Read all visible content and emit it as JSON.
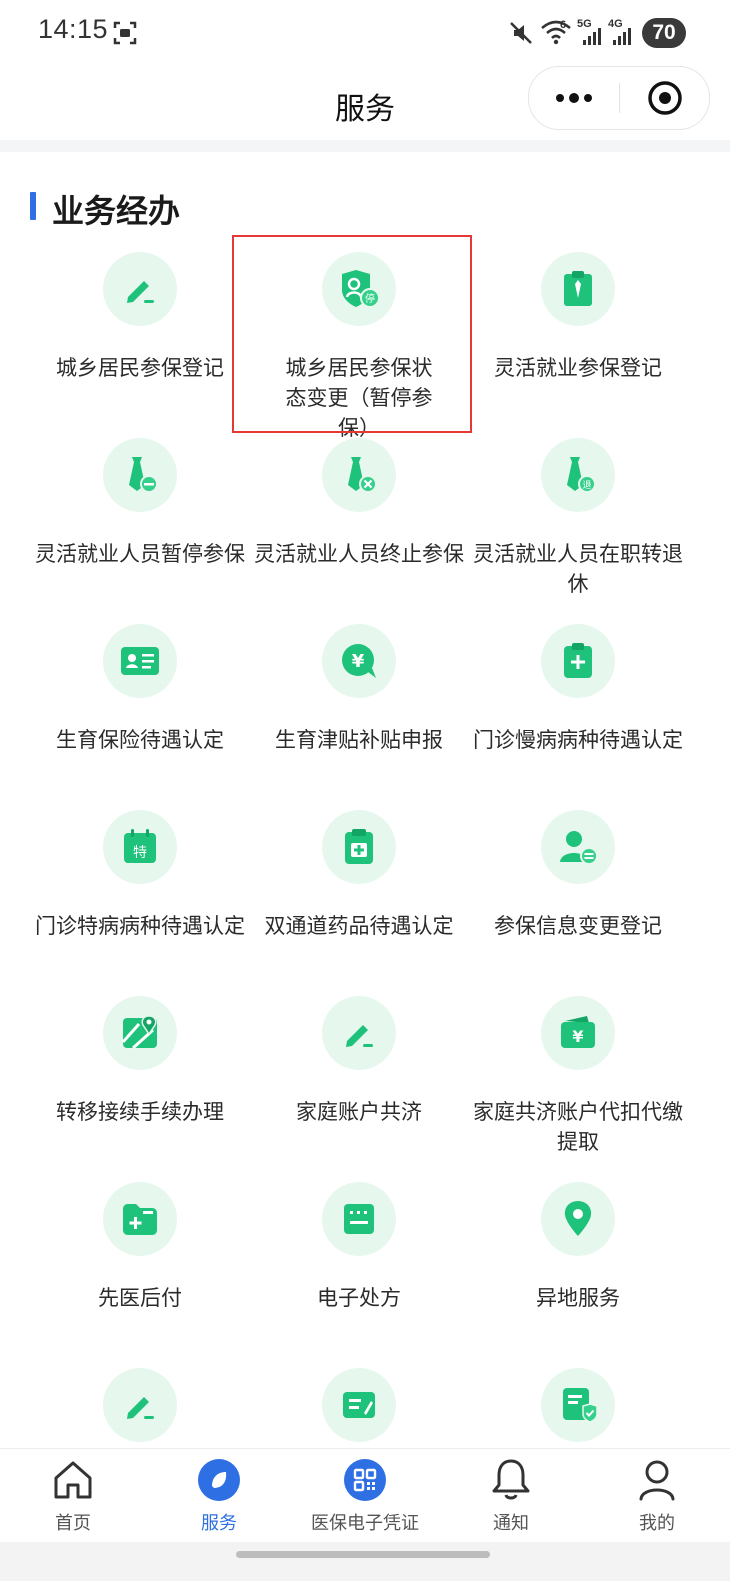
{
  "status": {
    "time": "14:15",
    "wifi_label": "6",
    "signal1_label": "5G",
    "signal2_label": "4G",
    "battery": "70"
  },
  "nav": {
    "title": "服务"
  },
  "section": {
    "title": "业务经办"
  },
  "services": [
    {
      "label": "城乡居民参保登记",
      "icon": "pencil-icon"
    },
    {
      "label": "城乡居民参保状态变更（暂停参保）",
      "icon": "shield-person-pause-icon"
    },
    {
      "label": "灵活就业参保登记",
      "icon": "clipboard-tie-icon"
    },
    {
      "label": "灵活就业人员暂停参保",
      "icon": "tie-minus-icon"
    },
    {
      "label": "灵活就业人员终止参保",
      "icon": "tie-close-icon"
    },
    {
      "label": "灵活就业人员在职转退休",
      "icon": "tie-retire-icon"
    },
    {
      "label": "生育保险待遇认定",
      "icon": "id-card-icon"
    },
    {
      "label": "生育津贴补贴申报",
      "icon": "yuan-coin-icon"
    },
    {
      "label": "门诊慢病病种待遇认定",
      "icon": "clipboard-plus-icon"
    },
    {
      "label": "门诊特病病种待遇认定",
      "icon": "calendar-special-icon"
    },
    {
      "label": "双通道药品待遇认定",
      "icon": "medicine-clipboard-icon"
    },
    {
      "label": "参保信息变更登记",
      "icon": "person-edit-icon"
    },
    {
      "label": "转移接续手续办理",
      "icon": "map-pin-icon"
    },
    {
      "label": "家庭账户共济",
      "icon": "pencil-icon"
    },
    {
      "label": "家庭共济账户代扣代缴提取",
      "icon": "wallet-yuan-icon"
    },
    {
      "label": "先医后付",
      "icon": "folder-plus-icon"
    },
    {
      "label": "电子处方",
      "icon": "prescription-icon"
    },
    {
      "label": "异地服务",
      "icon": "location-icon"
    },
    {
      "label": "",
      "icon": "pencil-icon"
    },
    {
      "label": "",
      "icon": "document-edit-icon"
    },
    {
      "label": "",
      "icon": "document-shield-icon"
    }
  ],
  "tabs": [
    {
      "label": "首页",
      "icon": "home-icon"
    },
    {
      "label": "服务",
      "icon": "compass-icon"
    },
    {
      "label": "医保电子凭证",
      "icon": "qr-code-icon"
    },
    {
      "label": "通知",
      "icon": "bell-icon"
    },
    {
      "label": "我的",
      "icon": "user-icon"
    }
  ],
  "colors": {
    "accent": "#2f6fe4",
    "icon_green": "#1fc27a",
    "icon_bg": "#e6f8ee",
    "highlight": "#e53935"
  }
}
